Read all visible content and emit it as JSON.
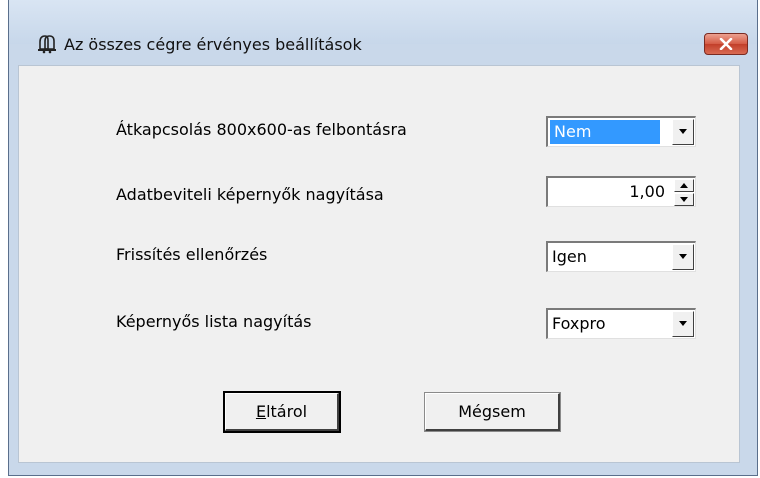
{
  "window": {
    "title": "Az összes cégre érvényes beállítások",
    "icon": "bell-icon",
    "close_icon": "close-icon"
  },
  "settings": [
    {
      "label": "Átkapcsolás 800x600-as felbontásra",
      "control": "dropdown",
      "value": "Nem",
      "selected": true
    },
    {
      "label": "Adatbeviteli képernyők nagyítása",
      "control": "spinner",
      "value": "1,00"
    },
    {
      "label": "Frissítés ellenőrzés",
      "control": "dropdown",
      "value": "Igen"
    },
    {
      "label": "Képernyős lista nagyítás",
      "control": "dropdown",
      "value": "Foxpro"
    }
  ],
  "buttons": {
    "save_mnemonic": "E",
    "save_rest": "ltárol",
    "cancel": "Mégsem"
  },
  "colors": {
    "titlebar": "#c7d7ea",
    "client_bg": "#f0f0f0",
    "selection": "#3399ff",
    "close_button": "#d45a44"
  }
}
